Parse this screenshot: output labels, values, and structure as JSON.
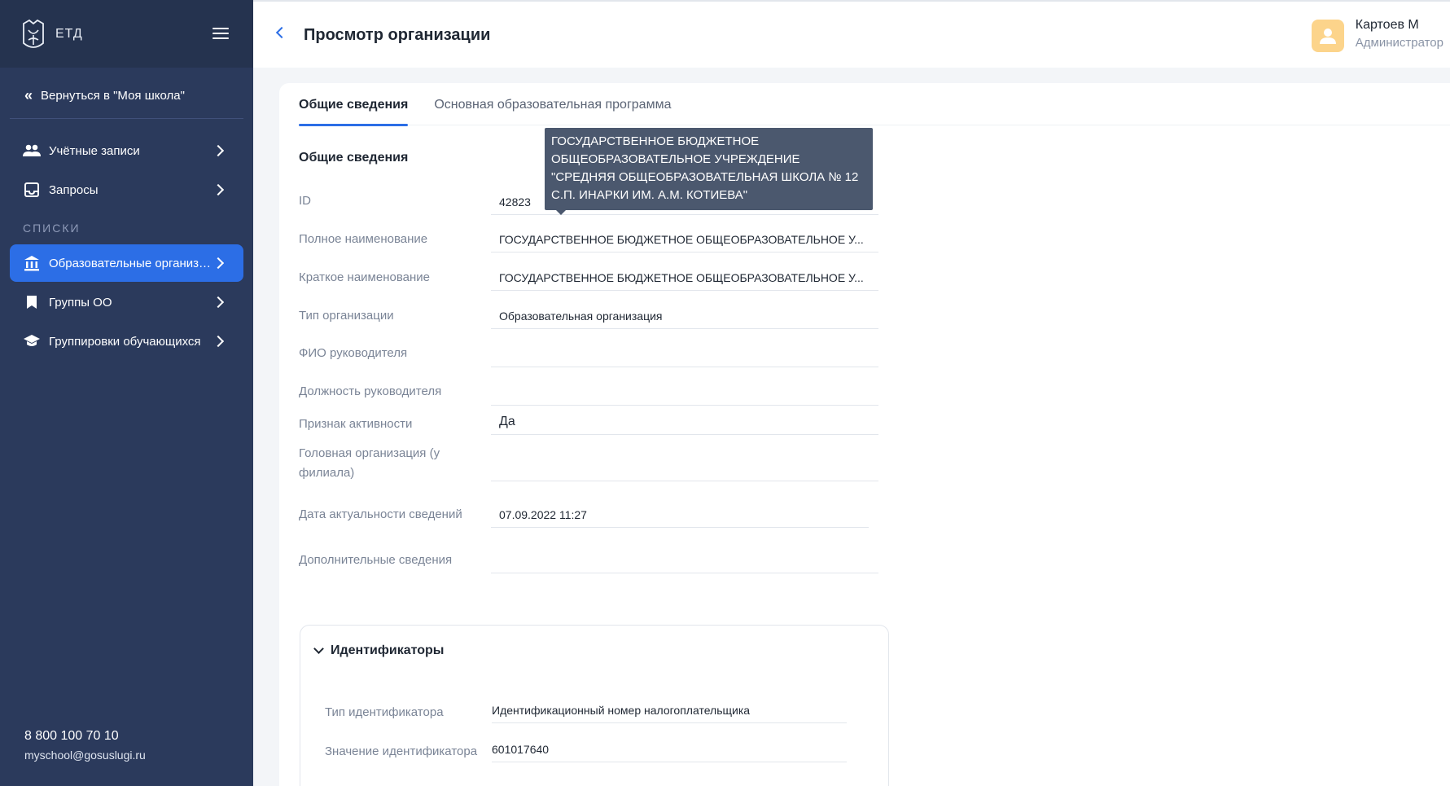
{
  "app": {
    "logo_text": "ЕТД"
  },
  "sidebar": {
    "back_label": "Вернуться в \"Моя школа\"",
    "items_top": [
      {
        "label": "Учётные записи",
        "icon": "users-icon"
      },
      {
        "label": "Запросы",
        "icon": "inbox-icon"
      }
    ],
    "section_label": "СПИСКИ",
    "items_lists": [
      {
        "label": "Образовательные организации",
        "icon": "institution-icon",
        "active": true
      },
      {
        "label": "Группы ОО",
        "icon": "bookmark-icon"
      },
      {
        "label": "Группировки обучающихся",
        "icon": "graduation-cap-icon"
      }
    ],
    "phone": "8 800 100 70 10",
    "email": "myschool@gosuslugi.ru"
  },
  "header": {
    "title": "Просмотр организации",
    "user_name": "Картоев М",
    "user_role": "Администратор"
  },
  "tabs": [
    {
      "label": "Общие сведения",
      "active": true
    },
    {
      "label": "Основная образовательная программа",
      "active": false
    }
  ],
  "general": {
    "section_title": "Общие сведения",
    "fields": {
      "id": {
        "label": "ID",
        "value": "42823"
      },
      "full_name": {
        "label": "Полное наименование",
        "value": "ГОСУДАРСТВЕННОЕ БЮДЖЕТНОЕ ОБЩЕОБРАЗОВАТЕЛЬНОЕ У..."
      },
      "short_name": {
        "label": "Краткое наименование",
        "value": "ГОСУДАРСТВЕННОЕ БЮДЖЕТНОЕ ОБЩЕОБРАЗОВАТЕЛЬНОЕ У..."
      },
      "org_type": {
        "label": "Тип организации",
        "value": "Образовательная организация"
      },
      "head_name": {
        "label": "ФИО руководителя",
        "value": ""
      },
      "head_position": {
        "label": "Должность руководителя",
        "value": ""
      },
      "active_flag": {
        "label": "Признак активности",
        "value": "Да"
      },
      "parent_org": {
        "label": "Головная организация (у филиала)",
        "value": ""
      },
      "actual_date": {
        "label": "Дата актуальности сведений",
        "value": "07.09.2022 11:27"
      },
      "additional": {
        "label": "Дополнительные сведения",
        "value": ""
      }
    },
    "tooltip": "ГОСУДАРСТВЕННОЕ БЮДЖЕТНОЕ ОБЩЕОБРАЗОВАТЕЛЬНОЕ УЧРЕЖДЕНИЕ \"СРЕДНЯЯ ОБЩЕОБРАЗОВАТЕЛЬНАЯ ШКОЛА № 12 С.П. ИНАРКИ ИМ. А.М. КОТИЕВА\""
  },
  "identifiers": {
    "title": "Идентификаторы",
    "type_label": "Тип идентификатора",
    "type_value": "Идентификационный номер налогоплательщика",
    "value_label": "Значение идентификатора",
    "value_value": "601017640"
  },
  "colors": {
    "sidebar_bg": "#2b3a5c",
    "accent": "#2c6ee6",
    "avatar_bg": "#fcd48b",
    "tooltip_bg": "#4b586e"
  }
}
